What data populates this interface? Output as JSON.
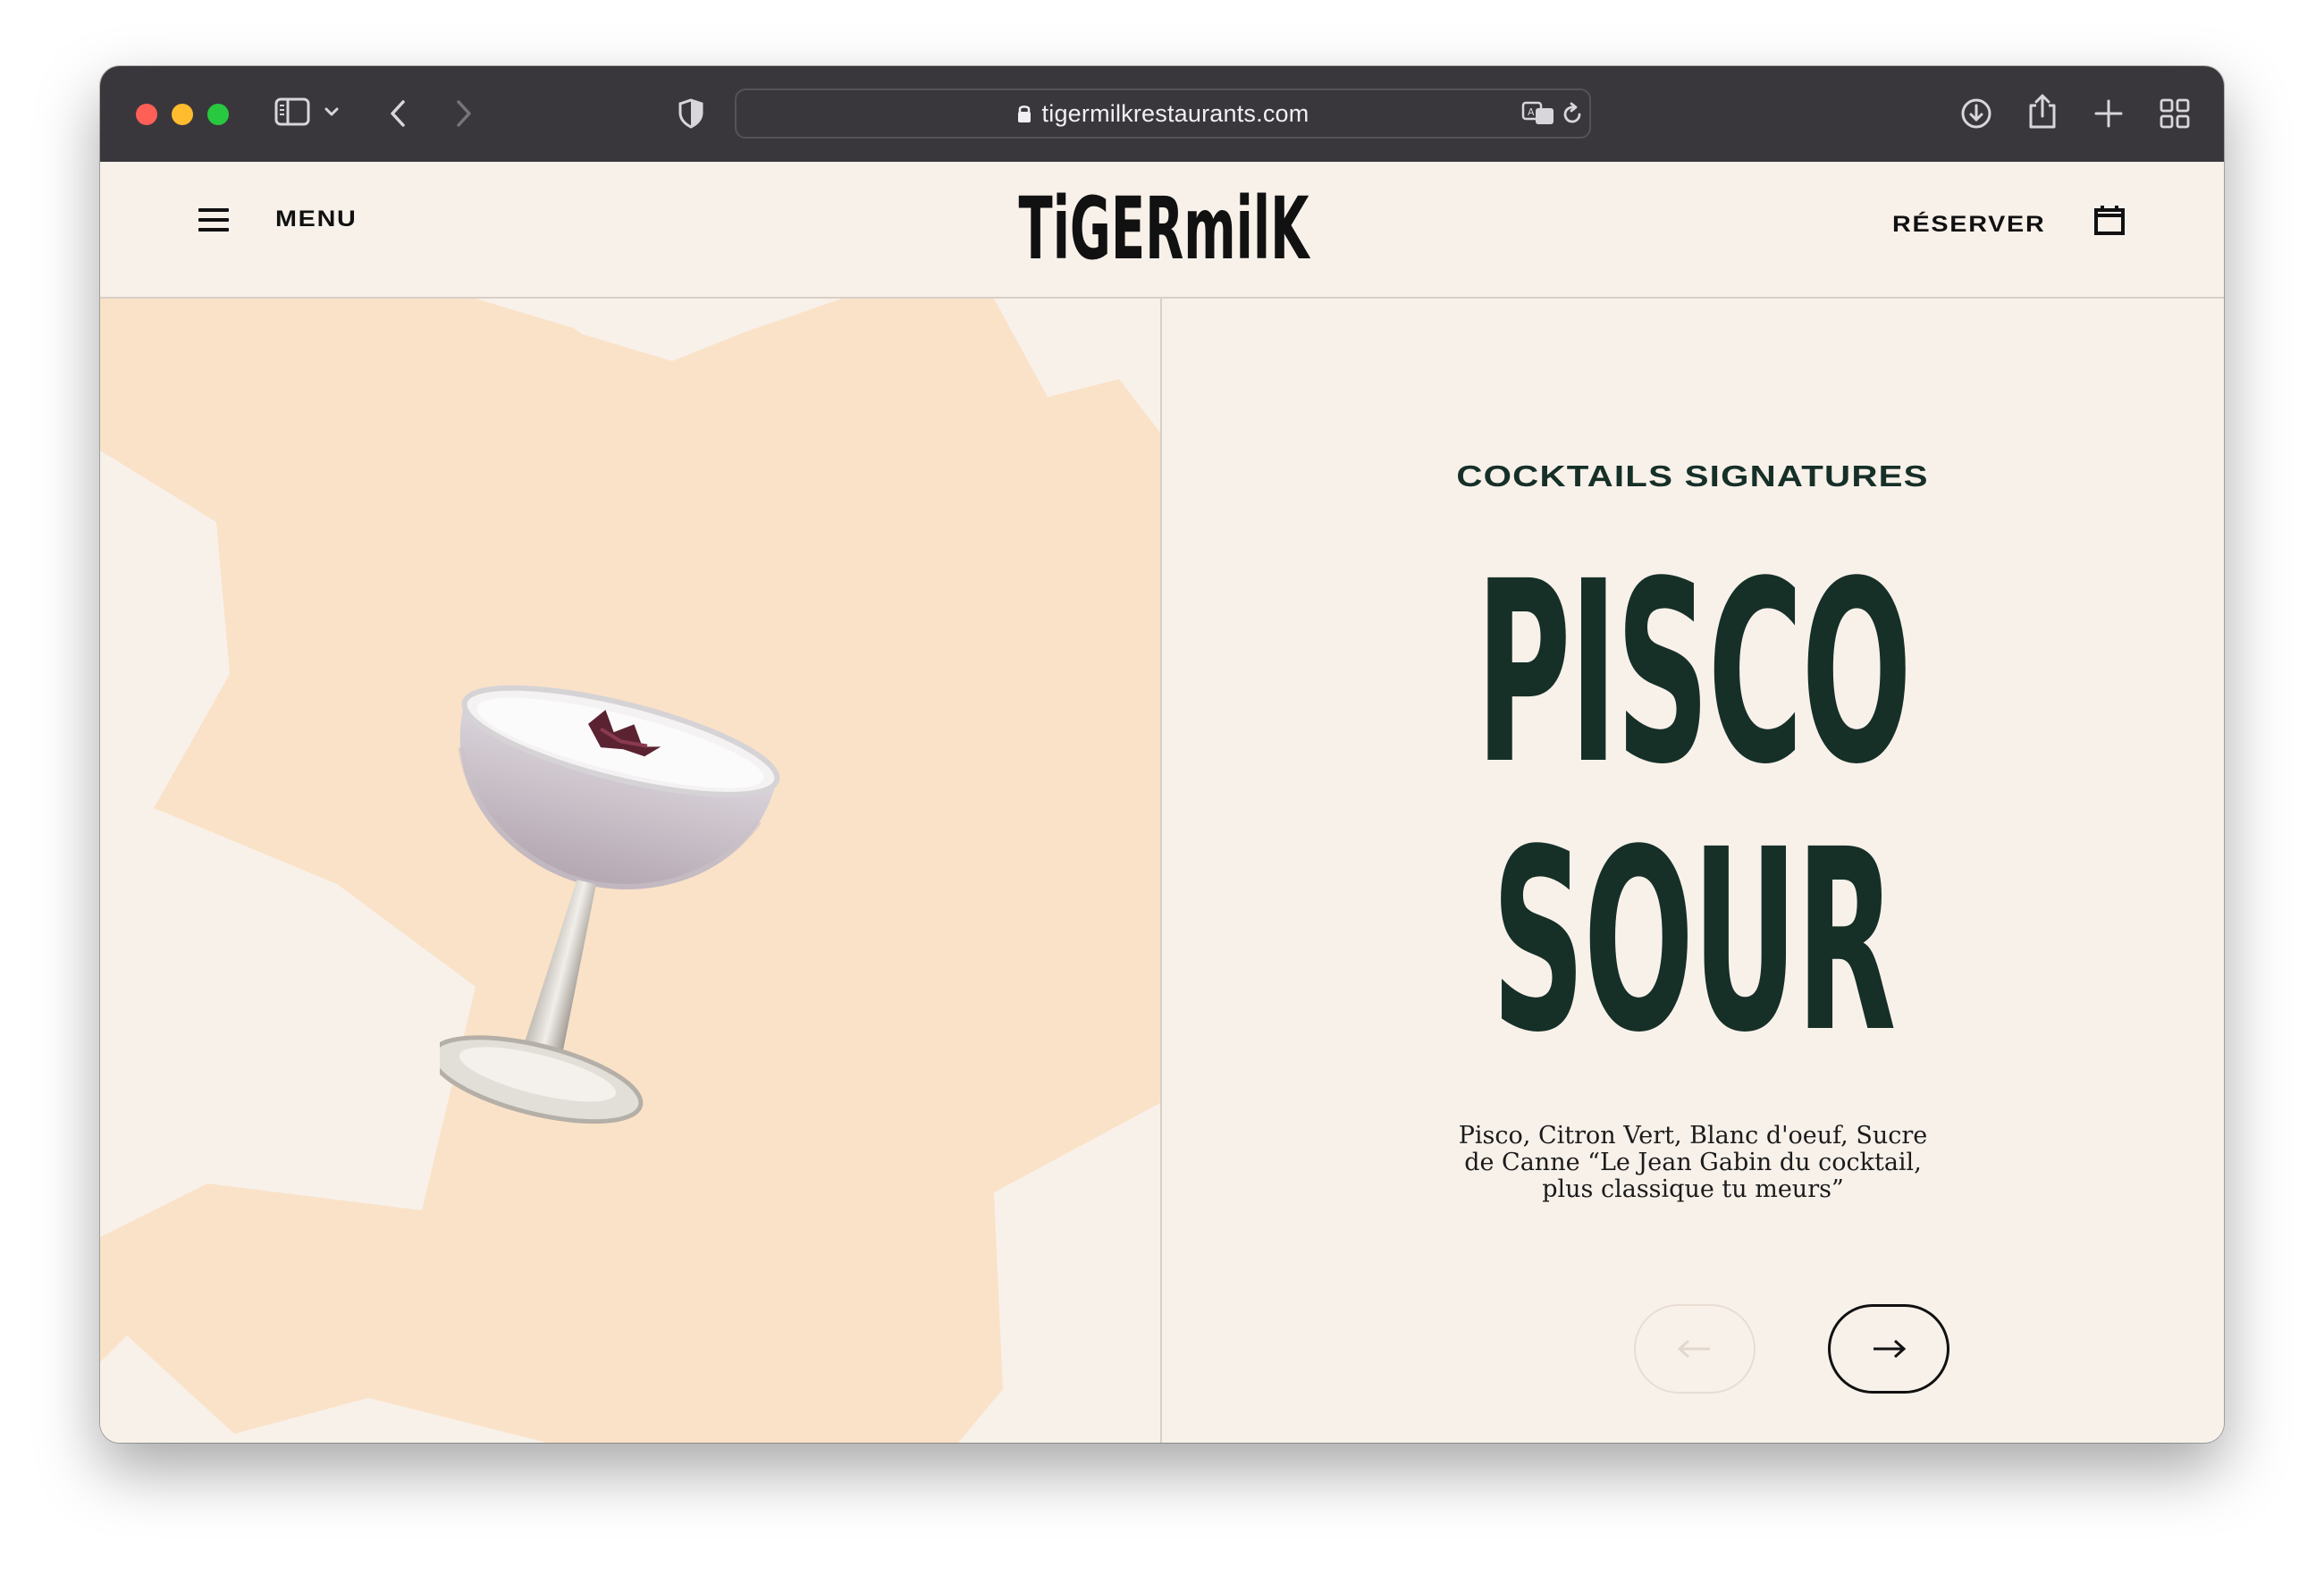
{
  "browser": {
    "url": "tigermilkrestaurants.com"
  },
  "header": {
    "menu_label": "MENU",
    "logo_text": "TiGERmilK",
    "reserve_label": "RÉSERVER"
  },
  "product": {
    "category": "COCKTAILS SIGNATURES",
    "title_lines": [
      "PISCO",
      "SOUR"
    ],
    "description": "Pisco, Citron Vert, Blanc d'oeuf, Sucre de Canne “Le Jean Gabin du cocktail, plus classique tu meurs”"
  },
  "colors": {
    "background": "#f8f1ea",
    "shape": "#fae2c8",
    "title": "#163028",
    "toolbar": "#3a373c"
  },
  "icons": {
    "menu": "hamburger-icon",
    "calendar": "calendar-icon",
    "prev": "arrow-left-icon",
    "next": "arrow-right-icon"
  }
}
